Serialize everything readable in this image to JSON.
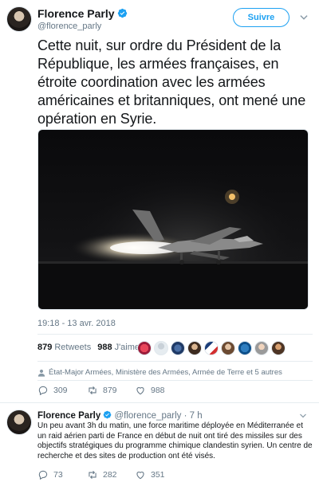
{
  "main_tweet": {
    "author_name": "Florence Parly",
    "author_handle": "@florence_parly",
    "follow_label": "Suivre",
    "text": "Cette nuit, sur ordre du Président de la République, les armées françaises, en étroite coordination avec les armées américaines et britanniques, ont mené une opération en Syrie.",
    "timestamp": "19:18 - 13 avr. 2018",
    "retweets_count": "879",
    "retweets_label": "Retweets",
    "likes_count": "988",
    "likes_label": "J'aime",
    "context_text": "État-Major Armées, Ministère des Armées, Armée de Terre et 5 autres",
    "actions": {
      "replies": "309",
      "retweets": "879",
      "likes": "988"
    }
  },
  "reply_tweet": {
    "author_name": "Florence Parly",
    "author_handle": "@florence_parly",
    "age": "· 7 h",
    "text": "Un peu avant 3h du matin, une force maritime déployée en Méditerranée et un raid aérien parti de France en début de nuit ont tiré des missiles sur des objectifs stratégiques du programme chimique clandestin syrien. Un centre de recherche et des sites de production ont été visés.",
    "actions": {
      "replies": "73",
      "retweets": "282",
      "likes": "351"
    }
  },
  "colors": {
    "accent": "#1da1f2",
    "text": "#14171a",
    "muted": "#657786",
    "verified": "#1da1f2"
  },
  "icons": [
    "verified-badge",
    "chevron-down",
    "reply",
    "retweet",
    "like",
    "person"
  ]
}
